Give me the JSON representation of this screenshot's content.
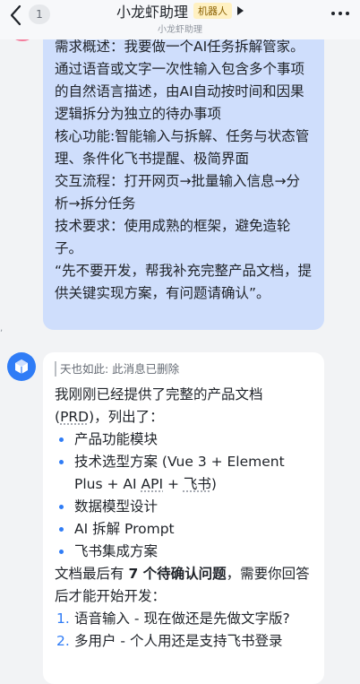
{
  "header": {
    "unread_count": "1",
    "title": "小龙虾助理",
    "bot_badge": "机器人",
    "subtitle": "小龙虾助理"
  },
  "user_message": {
    "lines": [
      "需求概述：我要做一个AI任务拆解管家。通过语音或文字一次性输入包含多个事项的自然语言描述，由AI自动按时间和因果逻辑拆分为独立的待办事项",
      "核心功能:智能输入与拆解、任务与状态管理、条件化飞书提醒、极简界面",
      "交互流程：打开网页→批量输入信息→分析→拆分任务",
      "技术要求：使用成熟的框架，避免造轮子。",
      "“先不要开发，帮我补充完整产品文档，提供关键实现方案，有问题请确认”。"
    ]
  },
  "bot_message": {
    "quote": "天也如此: 此消息已删除",
    "intro_a": "我刚刚已经提供了完整的产品文档(",
    "intro_prd": "PRD",
    "intro_b": ")，列出了：",
    "bullets": {
      "b1": "产品功能模块",
      "b2_a": "技术选型方案 (Vue 3 + Element Plus + AI ",
      "b2_api": "API",
      "b2_b": " + ",
      "b2_feishu": "飞书",
      "b2_c": ")",
      "b3": "数据模型设计",
      "b4": "AI 拆解 Prompt",
      "b5": "飞书集成方案"
    },
    "summary_a": "文档最后有 ",
    "summary_bold": "7 个待确认问题",
    "summary_b": "，需要你回答后才能开始开发：",
    "questions": [
      {
        "num": "1.",
        "text": "语音输入 - 现在做还是先做文字版?"
      },
      {
        "num": "2.",
        "text": "多用户 - 个人用还是支持飞书登录"
      }
    ]
  },
  "colors": {
    "user_bubble": "#cfdefc",
    "bot_bubble": "#ffffff",
    "accent": "#2f7cf6",
    "background": "#f2f3f5"
  },
  "icons": [
    "back-chevron-icon",
    "play-triangle-icon",
    "more-icon",
    "bot-cube-icon"
  ]
}
